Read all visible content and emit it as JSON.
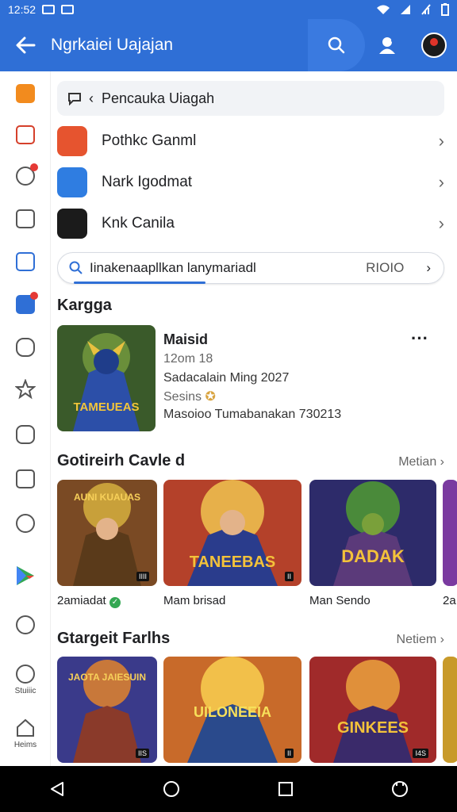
{
  "status": {
    "time": "12:52"
  },
  "appbar": {
    "title": "Ngrkaiei Uajajan"
  },
  "sidebar": {
    "items": [
      {
        "icon": "orange-app-icon"
      },
      {
        "icon": "music-note-icon"
      },
      {
        "icon": "gear-icon"
      },
      {
        "icon": "edit-square-icon"
      },
      {
        "icon": "calendar-icon"
      },
      {
        "icon": "home-app-icon"
      },
      {
        "icon": "puzzle-icon"
      },
      {
        "icon": "star-icon"
      },
      {
        "icon": "chat-icon"
      },
      {
        "icon": "info-icon"
      },
      {
        "icon": "compass-icon"
      },
      {
        "icon": "play-store-icon"
      },
      {
        "icon": "circle-icon"
      },
      {
        "icon": "settings-icon",
        "label": "Stuiiic"
      },
      {
        "icon": "home-icon",
        "label": "Heims"
      }
    ]
  },
  "search": {
    "value": "Pencauka Uiagah"
  },
  "list": [
    {
      "label": "Pothkc Ganml",
      "icon": "red-game-icon"
    },
    {
      "label": "Nark Igodmat",
      "icon": "blue-star-icon"
    },
    {
      "label": "Knk Canila",
      "icon": "dark-tile-icon"
    }
  ],
  "pill": {
    "text": "Iinakenaapllkan lanymariadl",
    "value": "RIOIO"
  },
  "featured": {
    "heading": "Kargga",
    "name": "Maisid",
    "line1": "12om 18",
    "line2": "Sadacalain Ming 2027",
    "line3": "Sesins",
    "line4": "Masoioo Tumabanakan 730213",
    "art_text": "TAMEUEAS"
  },
  "section1": {
    "heading": "Gotireirh Cavle d",
    "link": "Metian",
    "cards": [
      {
        "caption": "2amiadat",
        "verified": true,
        "art_text": "AUNI KUAUAS",
        "tag": "IIII"
      },
      {
        "caption": "Mam brisad",
        "verified": false,
        "art_text": "TANEEBAS",
        "tag": "II"
      },
      {
        "caption": "Man Sendo",
        "verified": false,
        "art_text": "DADAK",
        "tag": ""
      },
      {
        "caption": "2a",
        "verified": false,
        "art_text": "",
        "tag": ""
      }
    ]
  },
  "section2": {
    "heading": "Gtargeit Farlhs",
    "link": "Netiem",
    "cards": [
      {
        "art_text": "JAOTA JAIESUIN",
        "tag": "IIS"
      },
      {
        "art_text": "UILONEEIA",
        "tag": "II"
      },
      {
        "art_text": "GINKEES",
        "tag": "I4S"
      },
      {
        "art_text": "",
        "tag": ""
      }
    ]
  },
  "colors": {
    "primary": "#2f6fd6",
    "accent_green": "#34a853"
  }
}
